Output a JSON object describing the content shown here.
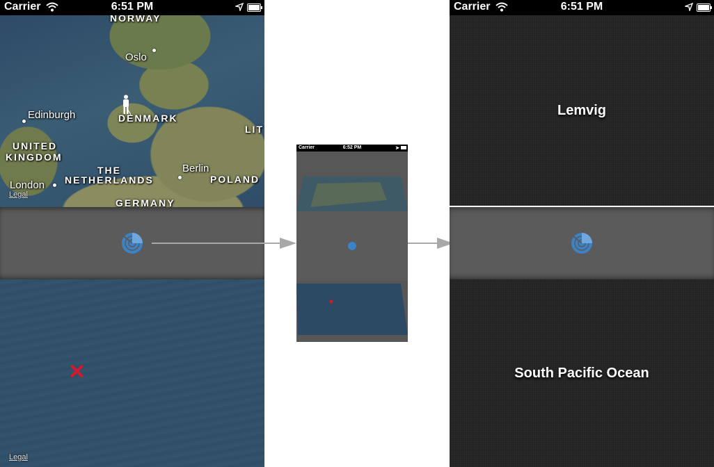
{
  "status_left": {
    "carrier": "Carrier",
    "time": "6:51 PM"
  },
  "status_right": {
    "carrier": "Carrier",
    "time": "6:51 PM"
  },
  "status_mini": {
    "carrier": "Carrier",
    "time": "6:52 PM"
  },
  "map_top": {
    "countries": [
      "NORWAY",
      "DENMARK",
      "UNITED",
      "KINGDOM",
      "THE",
      "NETHERLANDS",
      "GERMANY",
      "POLAND",
      "LIT"
    ],
    "cities": [
      "Oslo",
      "Edinburgh",
      "London",
      "Berlin"
    ],
    "legal": "Legal"
  },
  "map_bottom": {
    "legal": "Legal"
  },
  "panels": {
    "top_title": "Lemvig",
    "bottom_title": "South Pacific Ocean"
  },
  "colors": {
    "accent_blue": "#3b82c6",
    "marker_red": "#d7182a",
    "toolbar": "#5b5b5b",
    "panel": "#232323"
  },
  "icons": {
    "radar": "radar-globe-icon",
    "pin": "person-pin-icon",
    "marker": "x-marker-icon",
    "wifi": "wifi-icon",
    "location": "location-arrow-icon",
    "battery": "battery-icon",
    "arrow": "right-arrow-icon"
  }
}
